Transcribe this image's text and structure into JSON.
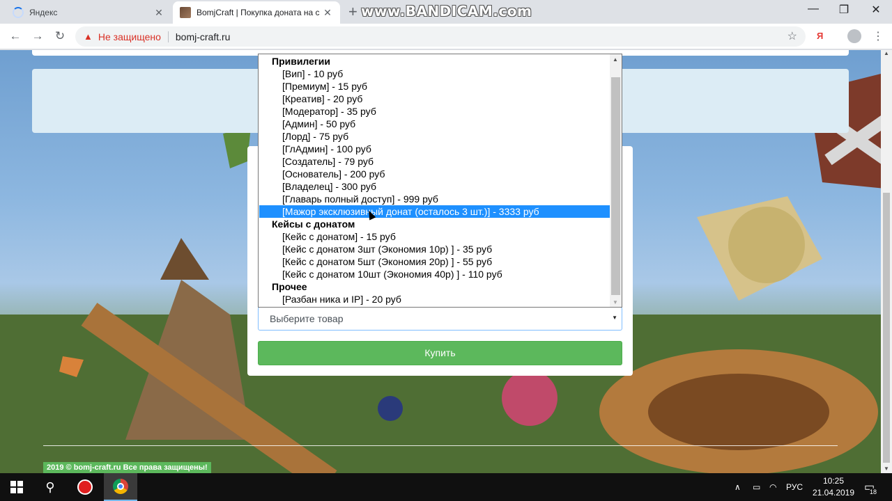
{
  "browser": {
    "tabs": [
      {
        "title": "Яндекс",
        "active": false
      },
      {
        "title": "BomjCraft | Покупка доната на с",
        "active": true
      }
    ],
    "watermark": "www.BANDICAM.com",
    "address": {
      "security_label": "Не защищено",
      "url": "bomj-craft.ru"
    },
    "extension_label": "Я"
  },
  "dropdown": {
    "groups": [
      {
        "label": "Привилегии",
        "options": [
          "[Вип] - 10 руб",
          "[Премиум] - 15 руб",
          "[Креатив] - 20 руб",
          "[Модератор] - 35 руб",
          "[Админ] - 50 руб",
          "[Лорд] - 75 руб",
          "[ГлАдмин] - 100 руб",
          "[Создатель] - 79 руб",
          "[Основатель] - 200 руб",
          "[Владелец] - 300 руб",
          "[Главарь полный доступ] - 999 руб",
          "[Мажор эксклюзивный донат (осталось 3 шт.)] - 3333 руб"
        ]
      },
      {
        "label": "Кейсы с донатом",
        "options": [
          "[Кейс с донатом] - 15 руб",
          "[Кейс с донатом 3шт (Экономия 10р) ] - 35 руб",
          "[Кейс с донатом 5шт (Экономия 20р) ] - 55 руб",
          "[Кейс с донатом 10шт (Экономия 40р) ] - 110 руб"
        ]
      },
      {
        "label": "Прочее",
        "options": [
          "[Разбан ника и IP] - 20 руб"
        ]
      }
    ],
    "highlighted": "[Мажор эксклюзивный донат (осталось 3 шт.)] - 3333 руб"
  },
  "form": {
    "select_placeholder": "Выберите товар",
    "buy_label": "Купить"
  },
  "footer": {
    "copyright": "2019 © bomj-craft.ru Все права защищены!"
  },
  "taskbar": {
    "language": "РУС",
    "time": "10:25",
    "date": "21.04.2019",
    "notifications": "18"
  },
  "colors": {
    "accent_green": "#5cb85c",
    "selection_blue": "#1e90ff",
    "insecure_red": "#d93025"
  }
}
